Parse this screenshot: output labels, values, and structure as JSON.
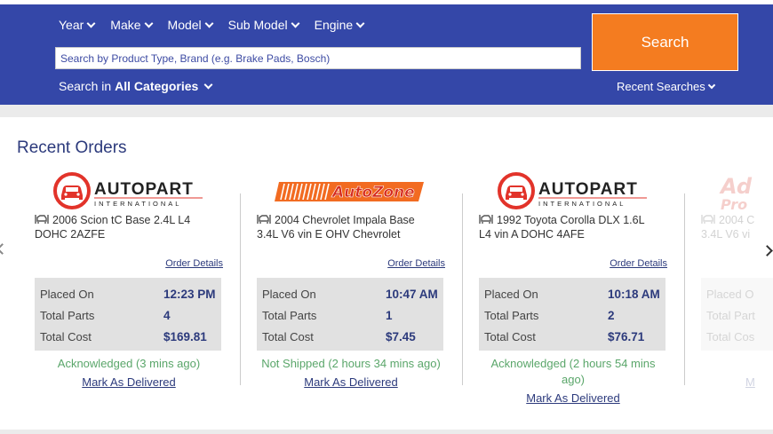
{
  "header": {
    "nav": [
      {
        "label": "Year"
      },
      {
        "label": "Make"
      },
      {
        "label": "Model"
      },
      {
        "label": "Sub Model"
      },
      {
        "label": "Engine"
      }
    ],
    "search_placeholder": "Search by Product Type, Brand (e.g. Brake Pads, Bosch)",
    "search_in_prefix": "Search in",
    "search_in_value": "All Categories",
    "search_button": "Search",
    "recent_searches": "Recent Searches"
  },
  "colors": {
    "header_bg": "#3447a8",
    "search_button": "#f47c20",
    "link": "#2c3a7c",
    "status_green": "#5aa66a"
  },
  "section_title": "Recent Orders",
  "orders": [
    {
      "store_logo": "autopart-international-logo",
      "vehicle_line1": "2006 Scion tC Base 2.4L L4",
      "vehicle_line2": "DOHC 2AZFE",
      "order_details": "Order Details",
      "placed_on_label": "Placed On",
      "placed_on": "12:23 PM",
      "total_parts_label": "Total Parts",
      "total_parts": "4",
      "total_cost_label": "Total Cost",
      "total_cost": "$169.81",
      "status": "Acknowledged (3 mins ago)",
      "mark_delivered": "Mark As Delivered"
    },
    {
      "store_logo": "autozone-logo",
      "vehicle_line1": "2004 Chevrolet Impala Base",
      "vehicle_line2": "3.4L V6 vin E OHV Chevrolet",
      "order_details": "Order Details",
      "placed_on_label": "Placed On",
      "placed_on": "10:47 AM",
      "total_parts_label": "Total Parts",
      "total_parts": "1",
      "total_cost_label": "Total Cost",
      "total_cost": "$7.45",
      "status": "Not Shipped (2 hours 34 mins ago)",
      "mark_delivered": "Mark As Delivered"
    },
    {
      "store_logo": "autopart-international-logo",
      "vehicle_line1": "1992 Toyota Corolla DLX 1.6L",
      "vehicle_line2": "L4 vin A DOHC 4AFE",
      "order_details": "Order Details",
      "placed_on_label": "Placed On",
      "placed_on": "10:18 AM",
      "total_parts_label": "Total Parts",
      "total_parts": "2",
      "total_cost_label": "Total Cost",
      "total_cost": "$76.71",
      "status_line1": "Acknowledged (2 hours 54 mins",
      "status_line2": "ago)",
      "mark_delivered": "Mark As Delivered"
    },
    {
      "store_logo": "advance-auto-parts-logo",
      "logo_text_1": "Ad",
      "logo_text_2": "Pro",
      "vehicle_line1": "2004 C",
      "vehicle_line2": "3.4L V6 vi",
      "placed_on_label": "Placed O",
      "total_parts_label": "Total Part",
      "total_cost_label": "Total Cos",
      "mark_delivered": "M"
    }
  ],
  "logos": {
    "autopart_line1": "AUTOPART",
    "autopart_line2": "INTERNATIONAL",
    "autozone": "AutoZone"
  }
}
